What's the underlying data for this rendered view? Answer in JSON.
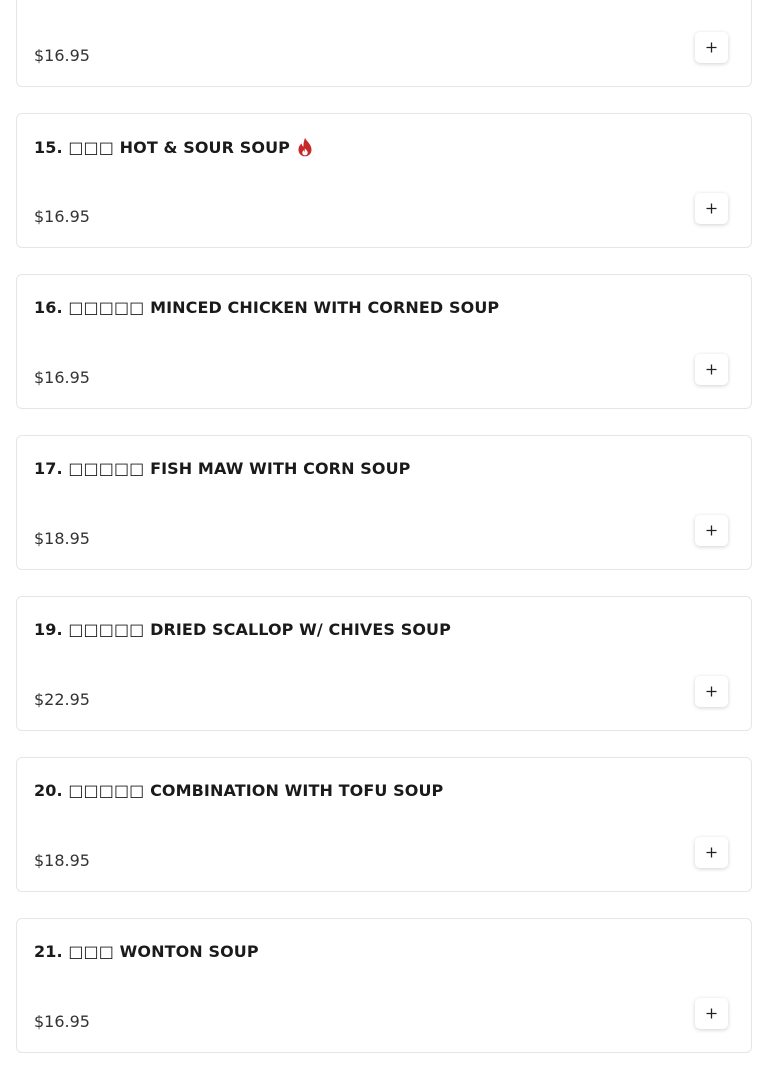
{
  "menu": {
    "items": [
      {
        "title": "",
        "price": "$16.95",
        "spicy": false
      },
      {
        "title": "15. □□□ HOT & SOUR SOUP",
        "price": "$16.95",
        "spicy": true
      },
      {
        "title": "16. □□□□□ MINCED CHICKEN WITH CORNED SOUP",
        "price": "$16.95",
        "spicy": false
      },
      {
        "title": "17. □□□□□ FISH MAW WITH CORN SOUP",
        "price": "$18.95",
        "spicy": false
      },
      {
        "title": "19. □□□□□ DRIED SCALLOP W/ CHIVES SOUP",
        "price": "$22.95",
        "spicy": false
      },
      {
        "title": "20. □□□□□ COMBINATION WITH TOFU SOUP",
        "price": "$18.95",
        "spicy": false
      },
      {
        "title": "21. □□□ WONTON SOUP",
        "price": "$16.95",
        "spicy": false
      }
    ]
  },
  "icons": {
    "add": "plus-icon",
    "spicy": "flame-icon"
  },
  "colors": {
    "flame": "#c62828",
    "border": "#e6e6e6"
  }
}
